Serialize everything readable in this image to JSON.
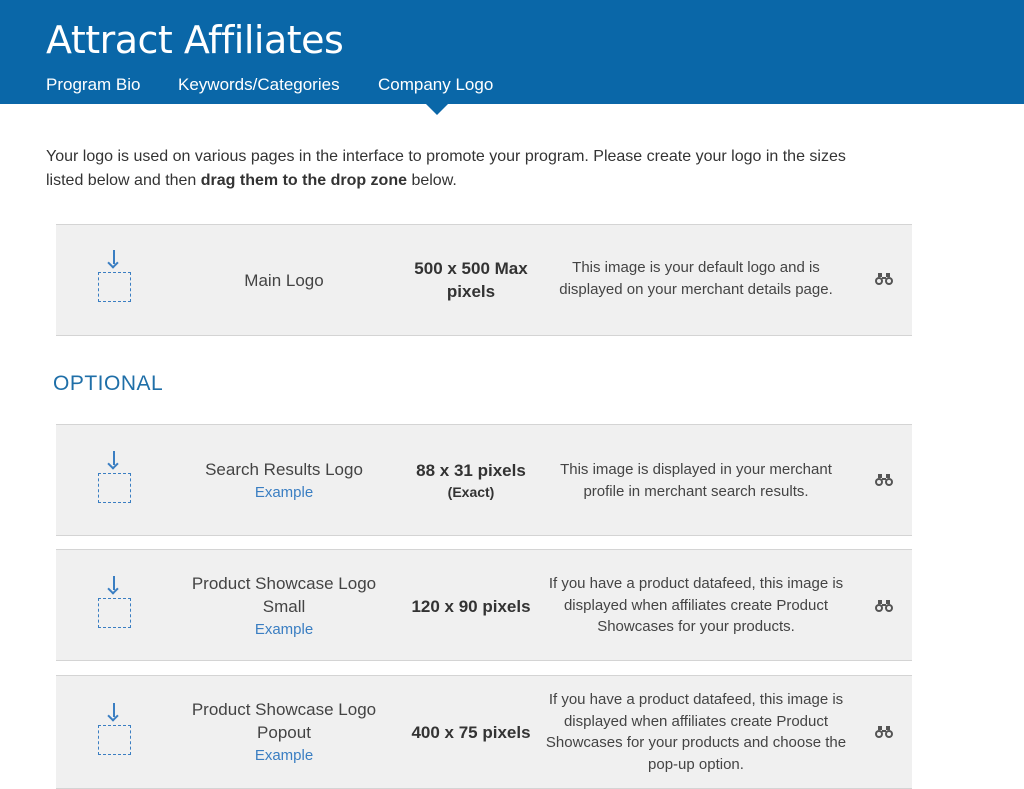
{
  "header": {
    "title": "Attract Affiliates",
    "tabs": [
      {
        "label": "Program Bio"
      },
      {
        "label": "Keywords/Categories"
      },
      {
        "label": "Company Logo"
      }
    ],
    "active_tab": "Company Logo",
    "bg_color": "#0a67a8"
  },
  "intro": {
    "text_before": "Your logo is used on various pages in the interface to promote your program. Please create your logo in the sizes listed below and then ",
    "text_bold": "drag them to the drop zone",
    "text_after": " below."
  },
  "required_logo": {
    "name": "Main Logo",
    "size": "500 x 500 Max pixels",
    "description": "This image is your default logo and is displayed on your merchant details page.",
    "drop_icon": "drop-zone-icon",
    "preview_icon": "binoculars-icon"
  },
  "optional_heading": "OPTIONAL",
  "optional_logos": [
    {
      "name": "Search Results Logo",
      "example": "Example",
      "size": "88 x 31 pixels",
      "size_note": "(Exact)",
      "description": "This image is displayed in your merchant profile in merchant search results."
    },
    {
      "name": "Product Showcase Logo Small",
      "example": "Example",
      "size": "120 x 90 pixels",
      "size_note": "",
      "description": "If you have a product datafeed, this image is displayed when affiliates create Product Showcases for your products."
    },
    {
      "name": "Product Showcase Logo Popout",
      "example": "Example",
      "size": "400 x 75 pixels",
      "size_note": "",
      "description": "If you have a product datafeed, this image is displayed when affiliates create Product Showcases for your products and choose the pop-up option."
    }
  ],
  "colors": {
    "accent": "#0a67a8",
    "link": "#3a7ec2",
    "row_bg": "#f0f0f0"
  }
}
